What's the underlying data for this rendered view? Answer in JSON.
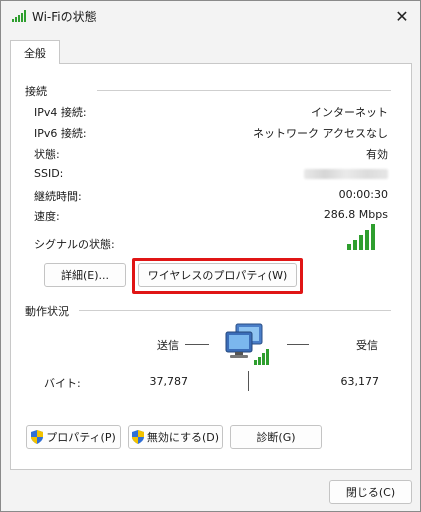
{
  "window": {
    "title": "Wi-Fiの状態",
    "close_glyph": "✕"
  },
  "tabs": [
    {
      "label": "全般"
    }
  ],
  "connection": {
    "section_label": "接続",
    "rows": [
      {
        "label": "IPv4 接続:",
        "value": "インターネット"
      },
      {
        "label": "IPv6 接続:",
        "value": "ネットワーク アクセスなし"
      },
      {
        "label": "状態:",
        "value": "有効"
      },
      {
        "label": "SSID:",
        "value": ""
      },
      {
        "label": "継続時間:",
        "value": "00:00:30"
      },
      {
        "label": "速度:",
        "value": "286.8 Mbps"
      }
    ],
    "signal_label": "シグナルの状態:",
    "signal_bars": 5,
    "details_button": "詳細(E)...",
    "wireless_props_button": "ワイヤレスのプロパティ(W)"
  },
  "activity": {
    "section_label": "動作状況",
    "sent_label": "送信",
    "received_label": "受信",
    "bytes_label": "バイト:",
    "bytes_sent": "37,787",
    "bytes_received": "63,177"
  },
  "buttons": {
    "properties": "プロパティ(P)",
    "disable": "無効にする(D)",
    "diagnose": "診断(G)",
    "close": "閉じる(C)"
  },
  "colors": {
    "signal_green": "#2e9e2e",
    "highlight_red": "#e01515",
    "window_bg": "#f3f3f3"
  }
}
